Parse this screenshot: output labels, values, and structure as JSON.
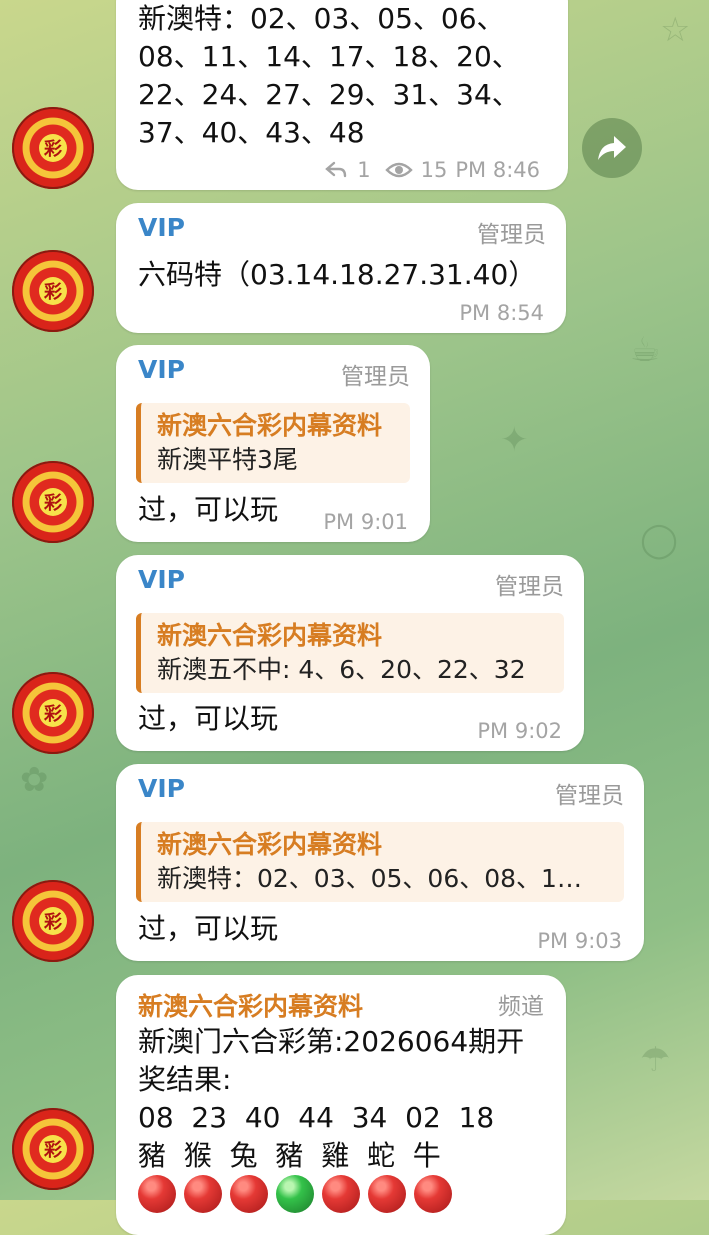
{
  "messages": {
    "m1": {
      "lines": [
        "新澳特：02、03、05、06、",
        "08、11、14、17、18、20、",
        "22、24、27、29、31、34、",
        "37、40、43、48"
      ],
      "replies": "1",
      "views": "15",
      "time": "PM 8:46"
    },
    "m2": {
      "sender": "VIP",
      "role": "管理员",
      "text": "六码特（03.14.18.27.31.40）",
      "time": "PM 8:54"
    },
    "m3": {
      "sender": "VIP",
      "role": "管理员",
      "quote_title": "新澳六合彩内幕资料",
      "quote_body": "新澳平特3尾",
      "text": "过，可以玩",
      "time": "PM 9:01"
    },
    "m4": {
      "sender": "VIP",
      "role": "管理员",
      "quote_title": "新澳六合彩内幕资料",
      "quote_body": "新澳五不中: 4、6、20、22、32",
      "text": "过，可以玩",
      "time": "PM 9:02"
    },
    "m5": {
      "sender": "VIP",
      "role": "管理员",
      "quote_title": "新澳六合彩内幕资料",
      "quote_body": "新澳特：02、03、05、06、08、1…",
      "text": "过，可以玩",
      "time": "PM 9:03"
    },
    "m6": {
      "sender": "新澳六合彩内幕资料",
      "role": "频道",
      "lines": [
        "新澳门六合彩第:2026064期开",
        "奖结果:"
      ],
      "numbers": "08  23  40  44  34  02  18",
      "zodiacs": "豬  猴  兔  豬  雞  蛇  牛",
      "ball_colors": [
        "red",
        "red",
        "red",
        "green",
        "red",
        "red",
        "red"
      ]
    }
  },
  "icons": {
    "avatar": "lottery-emblem-avatar",
    "forward": "share-arrow-icon",
    "reply": "reply-arrow-icon",
    "views": "eye-icon"
  },
  "colors": {
    "sender_blue": "#3a86c8",
    "channel_orange": "#d77d22",
    "ball_red": "#e53935",
    "ball_green": "#34c24a"
  }
}
